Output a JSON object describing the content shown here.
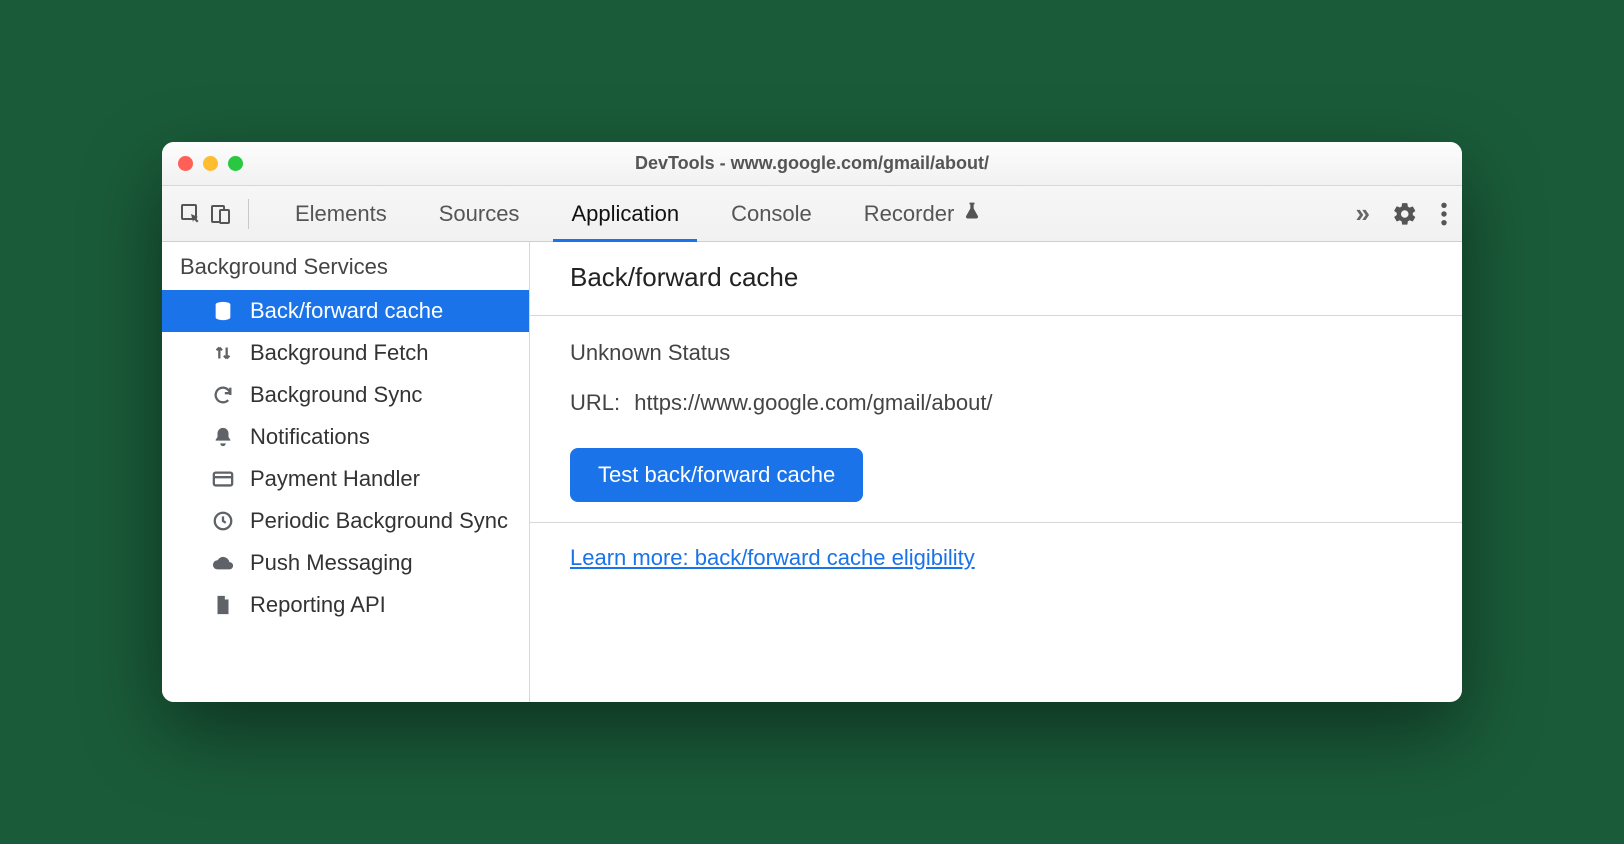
{
  "window": {
    "title": "DevTools - www.google.com/gmail/about/"
  },
  "tabs": {
    "items": [
      "Elements",
      "Sources",
      "Application",
      "Console",
      "Recorder"
    ],
    "active_index": 2
  },
  "sidebar": {
    "section_label": "Background Services",
    "items": [
      {
        "label": "Back/forward cache",
        "icon": "database-icon",
        "selected": true
      },
      {
        "label": "Background Fetch",
        "icon": "fetch-arrows-icon",
        "selected": false
      },
      {
        "label": "Background Sync",
        "icon": "sync-icon",
        "selected": false
      },
      {
        "label": "Notifications",
        "icon": "bell-icon",
        "selected": false
      },
      {
        "label": "Payment Handler",
        "icon": "credit-card-icon",
        "selected": false
      },
      {
        "label": "Periodic Background Sync",
        "icon": "clock-icon",
        "selected": false
      },
      {
        "label": "Push Messaging",
        "icon": "cloud-icon",
        "selected": false
      },
      {
        "label": "Reporting API",
        "icon": "document-icon",
        "selected": false
      }
    ]
  },
  "main": {
    "heading": "Back/forward cache",
    "status": "Unknown Status",
    "url_label": "URL:",
    "url_value": "https://www.google.com/gmail/about/",
    "test_button": "Test back/forward cache",
    "learn_more": "Learn more: back/forward cache eligibility"
  }
}
